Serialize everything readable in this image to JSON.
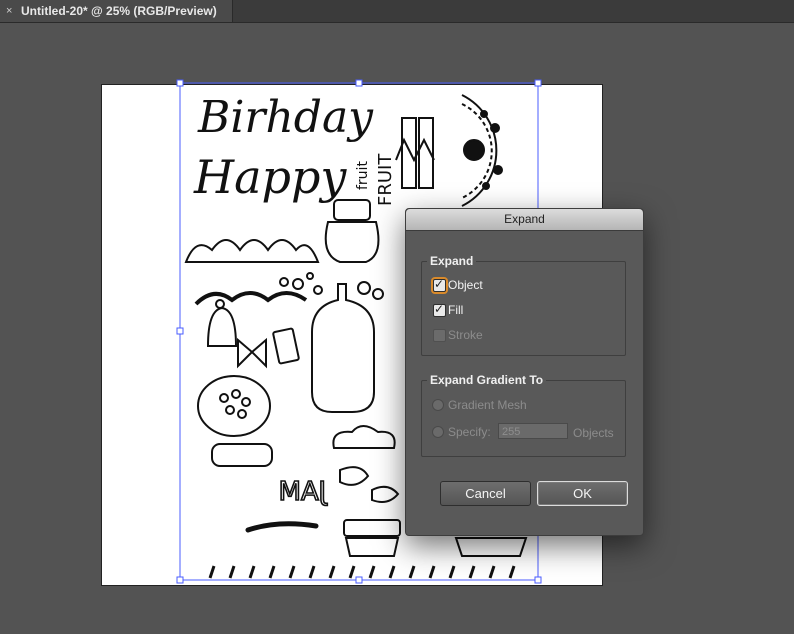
{
  "document_tab": {
    "close_glyph": "×",
    "title": "Untitled-20* @ 25% (RGB/Preview)"
  },
  "artwork": {
    "text_birthday": "Birhday",
    "text_happy": "Happy",
    "text_fruit": "fruit",
    "text_fruit_caps": "FRUIT",
    "text_jam": "JAM"
  },
  "dialog": {
    "title": "Expand",
    "expand_group": {
      "legend": "Expand",
      "object_label": "Object",
      "fill_label": "Fill",
      "stroke_label": "Stroke",
      "object_checked": true,
      "fill_checked": true,
      "stroke_checked": false
    },
    "gradient_group": {
      "legend": "Expand Gradient To",
      "gradient_mesh_label": "Gradient Mesh",
      "specify_label": "Specify:",
      "specify_value": "255",
      "objects_label": "Objects"
    },
    "cancel_label": "Cancel",
    "ok_label": "OK"
  },
  "colors": {
    "workspace": "#535353",
    "focus_ring": "#d98a2b",
    "selection": "#4a5cff"
  }
}
